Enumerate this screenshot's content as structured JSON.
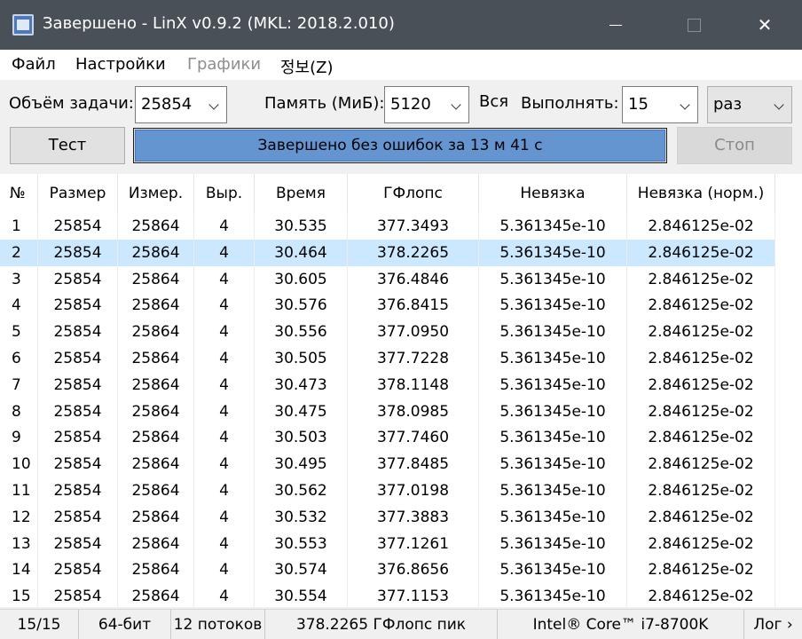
{
  "window": {
    "title": "Завершено - LinX v0.9.2 (MKL: 2018.2.010)",
    "minimize": "",
    "maximize": "",
    "close": "✕"
  },
  "menu": [
    "Файл",
    "Настройки",
    "Графики",
    "정보(Z)"
  ],
  "controls": {
    "problem_size_label": "Объём задачи:",
    "problem_size_value": "25854",
    "memory_label": "Память (МиБ):",
    "memory_value": "5120",
    "all_label": "Вся",
    "run_label": "Выполнять:",
    "run_value": "15",
    "run_unit": "раз",
    "test_button": "Тест",
    "stop_button": "Стоп",
    "progress_text": "Завершено без ошибок за 13 м 41 с",
    "progress_fraction": 1.0
  },
  "table": {
    "columns": [
      "№",
      "Размер",
      "Измер.",
      "Выр.",
      "Время",
      "ГФлопс",
      "Невязка",
      "Невязка (норм.)"
    ],
    "selected_row": 1,
    "rows": [
      [
        "1",
        "25854",
        "25864",
        "4",
        "30.535",
        "377.3493",
        "5.361345e-10",
        "2.846125e-02"
      ],
      [
        "2",
        "25854",
        "25864",
        "4",
        "30.464",
        "378.2265",
        "5.361345e-10",
        "2.846125e-02"
      ],
      [
        "3",
        "25854",
        "25864",
        "4",
        "30.605",
        "376.4846",
        "5.361345e-10",
        "2.846125e-02"
      ],
      [
        "4",
        "25854",
        "25864",
        "4",
        "30.576",
        "376.8415",
        "5.361345e-10",
        "2.846125e-02"
      ],
      [
        "5",
        "25854",
        "25864",
        "4",
        "30.556",
        "377.0950",
        "5.361345e-10",
        "2.846125e-02"
      ],
      [
        "6",
        "25854",
        "25864",
        "4",
        "30.505",
        "377.7228",
        "5.361345e-10",
        "2.846125e-02"
      ],
      [
        "7",
        "25854",
        "25864",
        "4",
        "30.473",
        "378.1148",
        "5.361345e-10",
        "2.846125e-02"
      ],
      [
        "8",
        "25854",
        "25864",
        "4",
        "30.475",
        "378.0985",
        "5.361345e-10",
        "2.846125e-02"
      ],
      [
        "9",
        "25854",
        "25864",
        "4",
        "30.503",
        "377.7460",
        "5.361345e-10",
        "2.846125e-02"
      ],
      [
        "10",
        "25854",
        "25864",
        "4",
        "30.495",
        "377.8485",
        "5.361345e-10",
        "2.846125e-02"
      ],
      [
        "11",
        "25854",
        "25864",
        "4",
        "30.562",
        "377.0198",
        "5.361345e-10",
        "2.846125e-02"
      ],
      [
        "12",
        "25854",
        "25864",
        "4",
        "30.532",
        "377.3883",
        "5.361345e-10",
        "2.846125e-02"
      ],
      [
        "13",
        "25854",
        "25864",
        "4",
        "30.553",
        "377.1261",
        "5.361345e-10",
        "2.846125e-02"
      ],
      [
        "14",
        "25854",
        "25864",
        "4",
        "30.574",
        "376.8656",
        "5.361345e-10",
        "2.846125e-02"
      ],
      [
        "15",
        "25854",
        "25864",
        "4",
        "30.554",
        "377.1153",
        "5.361345e-10",
        "2.846125e-02"
      ]
    ]
  },
  "status": [
    "15/15",
    "64-бит",
    "12 потоков",
    "378.2265 ГФлопс пик",
    "Intel® Core™ i7-8700K",
    "Лог ›"
  ]
}
